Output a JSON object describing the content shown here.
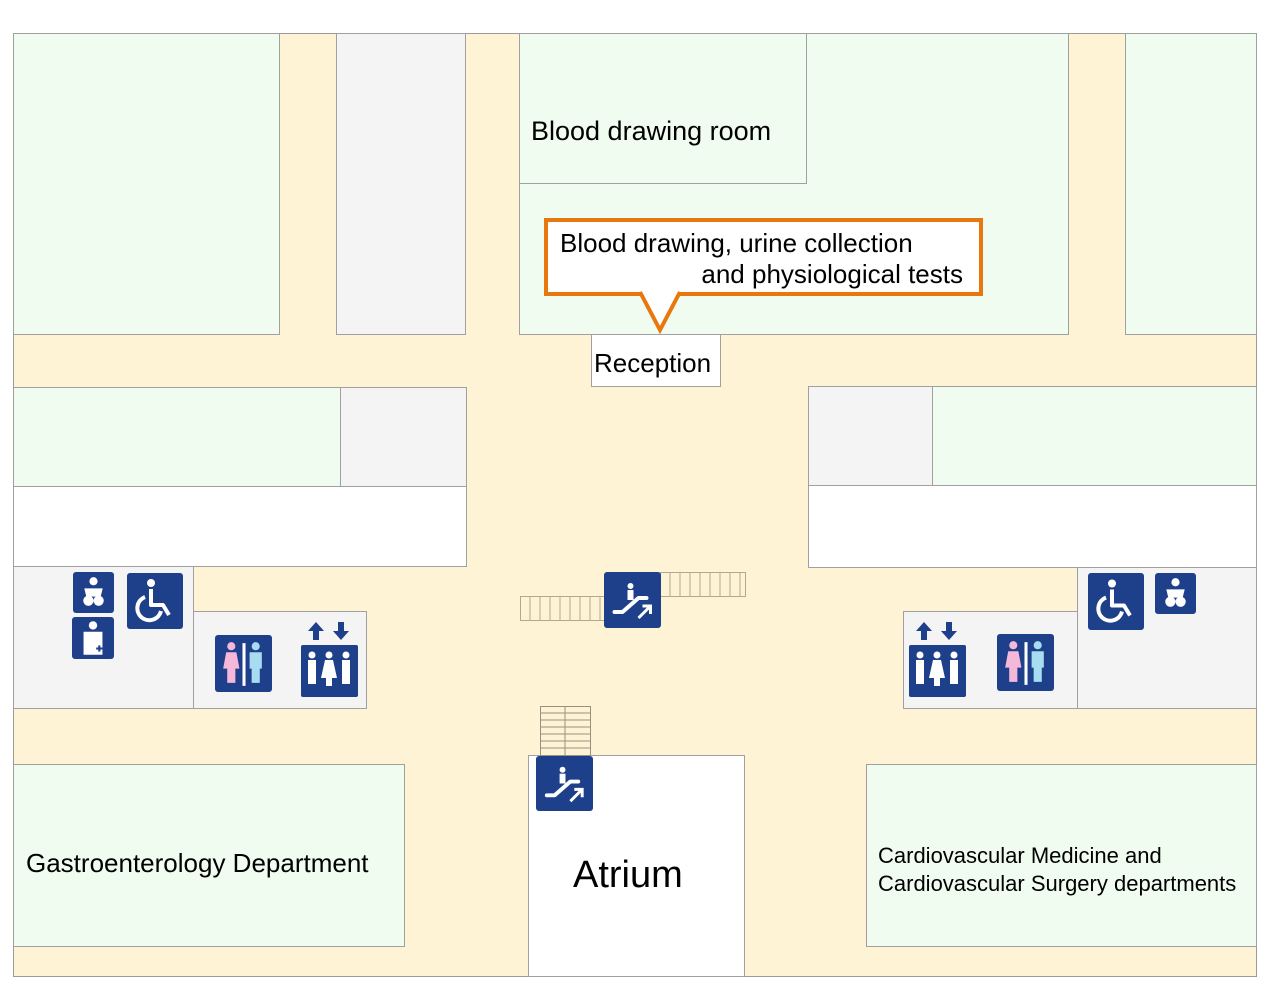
{
  "map": {
    "rooms": {
      "blood_drawing_room": "Blood drawing room",
      "reception": "Reception",
      "gastroenterology": "Gastroenterology Department",
      "atrium": "Atrium",
      "cardio_line1": "Cardiovascular Medicine and",
      "cardio_line2": "Cardiovascular Surgery departments"
    },
    "callout": {
      "line1": "Blood drawing, urine collection",
      "line2": "and physiological tests",
      "border_color": "#e8770e"
    },
    "icons": {
      "left_group": [
        "baby-changing-icon",
        "wheelchair-accessible-icon",
        "ostomate-icon",
        "restroom-icon",
        "elevator-icon"
      ],
      "center": [
        "escalator-icon"
      ],
      "atrium": [
        "escalator-icon"
      ],
      "right_group": [
        "elevator-icon",
        "restroom-icon",
        "wheelchair-accessible-icon",
        "baby-changing-icon"
      ]
    },
    "colors": {
      "corridor": "#fff3d6",
      "department": "#effcef",
      "service_area": "#f4f4f4",
      "icon_bg": "#1e3f8a",
      "female": "#f5b8d8",
      "male": "#a8dcf0"
    }
  }
}
